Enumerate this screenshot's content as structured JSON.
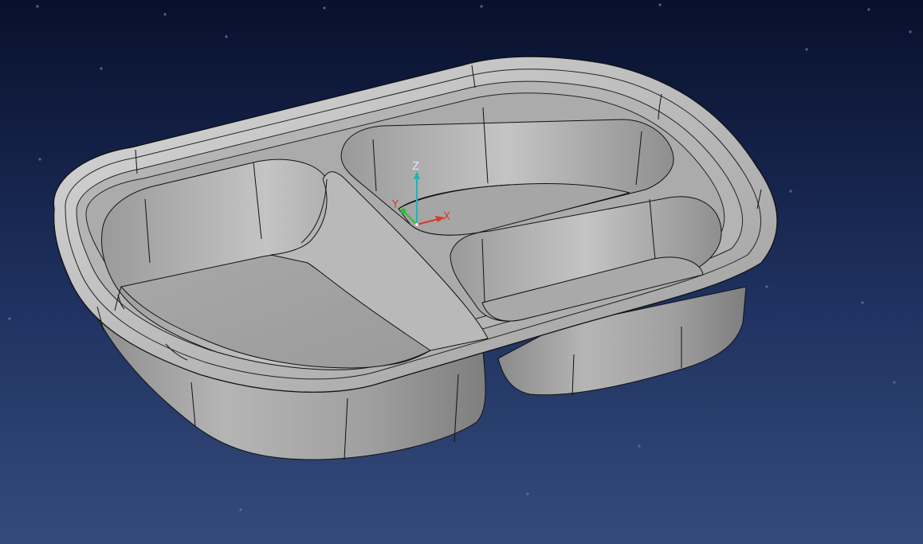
{
  "viewport": {
    "background_top": "#08102c",
    "background_bottom": "#334a78",
    "model_color": "#a9a9a9",
    "edge_color": "#111111"
  },
  "triad": {
    "z_label": "Z",
    "y_label": "Y",
    "x_label": "X",
    "z_color": "#1fb5b5",
    "y_color": "#2fc02f",
    "x_color": "#d83a2a"
  }
}
